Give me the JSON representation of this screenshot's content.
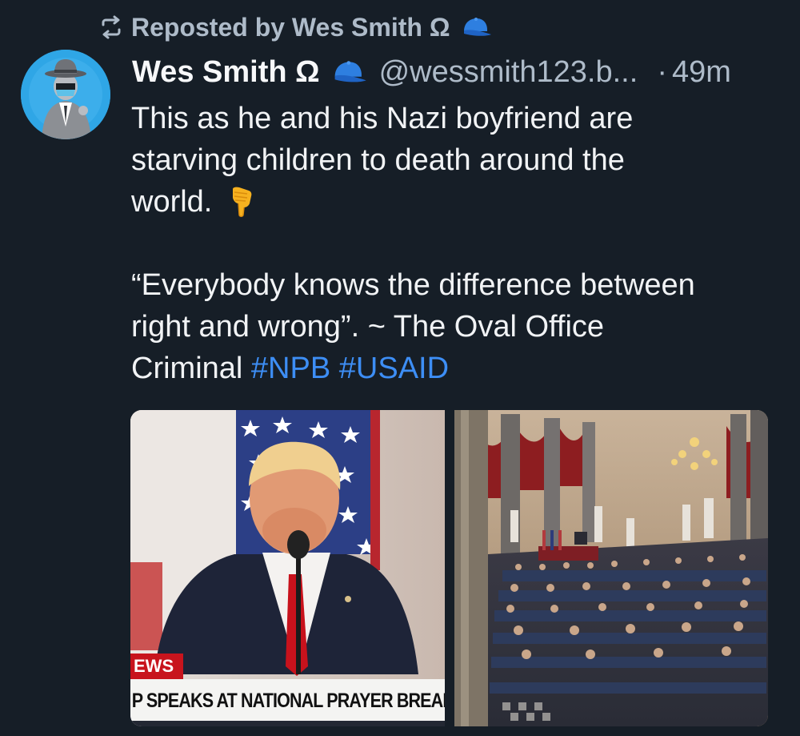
{
  "repost": {
    "label": "Reposted by Wes Smith Ω"
  },
  "author": {
    "display_name": "Wes Smith Ω",
    "handle": "@wessmith123.b...",
    "separator": "·",
    "time": "49m"
  },
  "post": {
    "line1": "This as he and his Nazi boyfriend are",
    "line2": "starving children to death around the",
    "line3": "world.",
    "quote_line1": "“Everybody knows the difference between",
    "quote_line2": "right and wrong”. ~ The Oval Office",
    "quote_line3_prefix": "Criminal",
    "hashtag1": "#NPB",
    "hashtag2": "#USAID"
  },
  "images": {
    "left_tag": "EWS",
    "left_caption": "P SPEAKS AT NATIONAL PRAYER BREAKI"
  },
  "colors": {
    "background": "#161e27",
    "text": "#f1f3f5",
    "muted": "#aebbc9",
    "hashtag": "#3d8ef5",
    "cap_icon": "#2e7fe0"
  },
  "icons": {
    "repost": "repost-icon",
    "cap": "blue-cap-icon",
    "emoji": "pointing-down-hand-emoji"
  }
}
